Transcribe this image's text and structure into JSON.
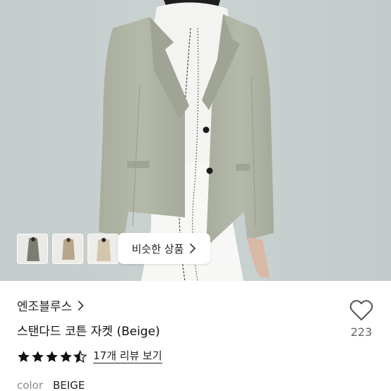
{
  "gallery": {
    "similar_button_label": "비슷한 상품",
    "thumbnails": [
      "thumbnail-1",
      "thumbnail-2",
      "thumbnail-3"
    ]
  },
  "product": {
    "brand": "엔조블루스",
    "title": "스탠다드 코튼 자켓 (Beige)",
    "rating": 4.5,
    "review_link_label": "17개 리뷰 보기",
    "color_label": "color",
    "color_value": "BEIGE",
    "likes": "223"
  },
  "icons": {
    "brand_chevron": "chevron-right-icon",
    "similar_chevron": "chevron-right-icon",
    "like": "heart-outline-icon",
    "rating": "star-icon"
  },
  "colors": {
    "star": "#111111",
    "background_photo": "#c5cdcd",
    "jacket": "#aeb3a4"
  }
}
